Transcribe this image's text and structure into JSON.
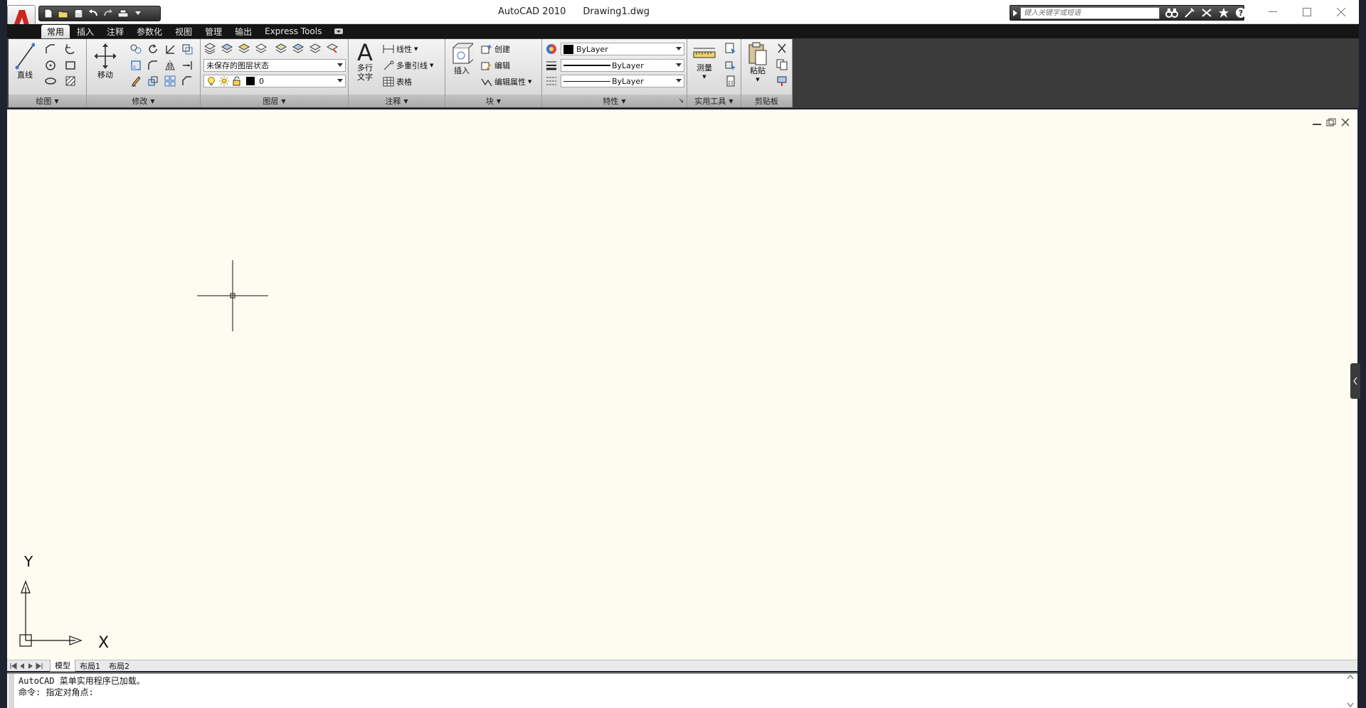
{
  "titlebar": {
    "app_name": "AutoCAD 2010",
    "file_name": "Drawing1.dwg",
    "search_placeholder": "键入关键字或短语"
  },
  "tabs": [
    {
      "label": "常用",
      "active": true
    },
    {
      "label": "插入"
    },
    {
      "label": "注释"
    },
    {
      "label": "参数化"
    },
    {
      "label": "视图"
    },
    {
      "label": "管理"
    },
    {
      "label": "输出"
    },
    {
      "label": "Express Tools"
    }
  ],
  "panels": {
    "draw": {
      "title": "绘图",
      "line_label": "直线"
    },
    "modify": {
      "title": "修改",
      "move_label": "移动"
    },
    "layers": {
      "title": "图层",
      "layer_state": "未保存的图层状态",
      "current_layer": "0"
    },
    "annotation": {
      "title": "注释",
      "mtext_label_1": "多行",
      "mtext_label_2": "文字",
      "linear_label": "线性",
      "mleader_label": "多重引线",
      "table_label": "表格"
    },
    "block": {
      "title": "块",
      "insert_label": "插入",
      "create_label": "创建",
      "edit_label": "编辑",
      "edit_attr_label": "编辑属性"
    },
    "properties": {
      "title": "特性",
      "color": "ByLayer",
      "lineweight": "ByLayer",
      "linetype": "ByLayer"
    },
    "utilities": {
      "title": "实用工具",
      "measure_label": "测量"
    },
    "clipboard": {
      "title": "剪贴板",
      "paste_label": "粘贴"
    }
  },
  "ucs": {
    "x_label": "X",
    "y_label": "Y"
  },
  "layout_tabs": [
    "模型",
    "布局1",
    "布局2"
  ],
  "command_history": [
    "AutoCAD 菜单实用程序已加载。",
    "命令: 指定对角点:"
  ],
  "colors": {
    "canvas_bg": "#fefcf0",
    "ribbon_dark": "#3b3b3b",
    "accent_red": "#c8281e"
  }
}
